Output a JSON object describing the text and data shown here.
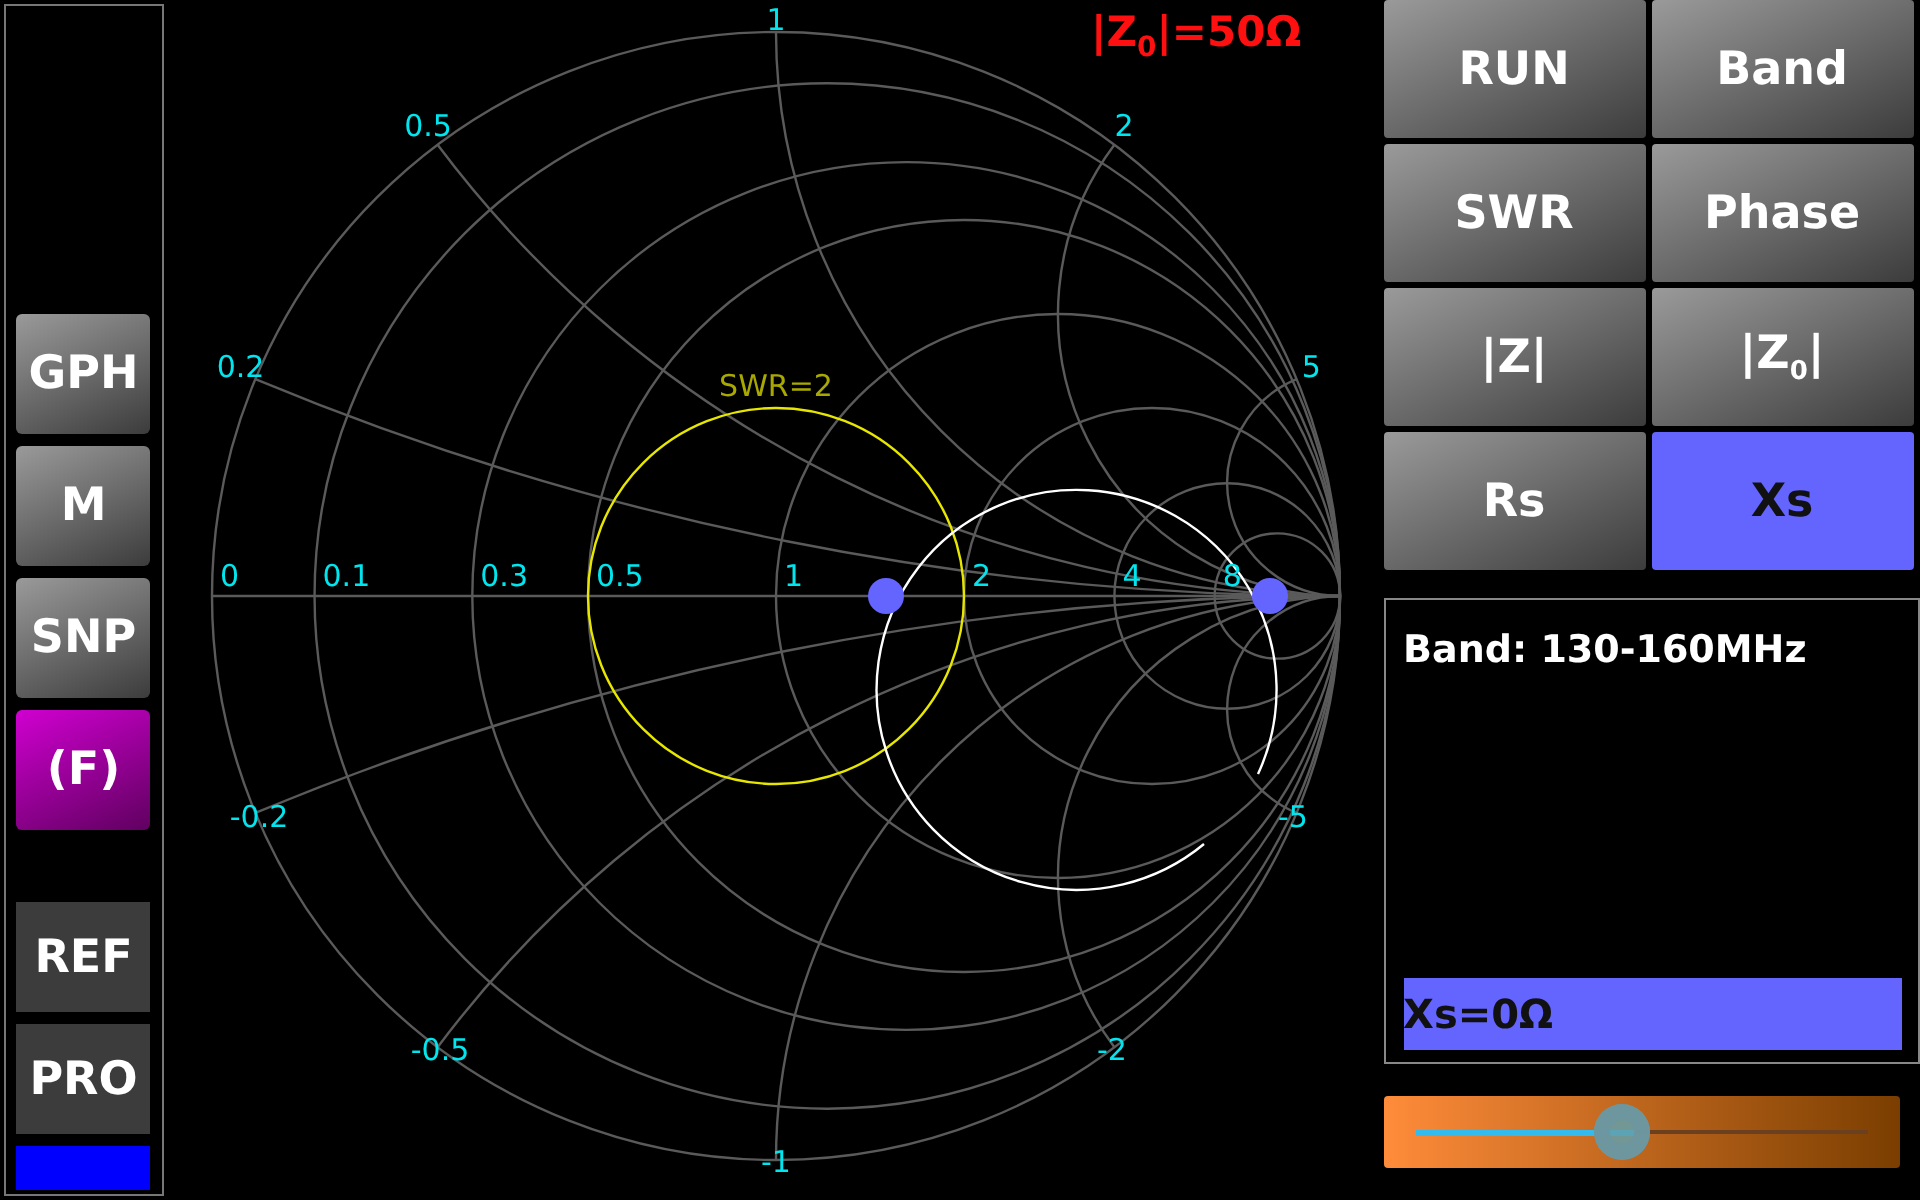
{
  "sidebar": {
    "buttons": [
      {
        "label": "GPH",
        "kind": "raised",
        "selected": false
      },
      {
        "label": "M",
        "kind": "raised",
        "selected": false
      },
      {
        "label": "SNP",
        "kind": "raised",
        "selected": false
      },
      {
        "label": "(F)",
        "kind": "raised",
        "selected": true
      },
      {
        "label": "REF",
        "kind": "flat",
        "selected": false
      },
      {
        "label": "PRO",
        "kind": "flat",
        "selected": false
      }
    ]
  },
  "chart": {
    "impedance_label": "|Z$_{0}$|=50Ω",
    "resistance_labels": [
      "0",
      "0.1",
      "0.3",
      "0.5",
      "1",
      "2",
      "4",
      "8"
    ],
    "reactance_labels": [
      "1",
      "0.5",
      "2",
      "0.2",
      "5",
      "-0.2",
      "-5",
      "-0.5",
      "-2",
      "-1"
    ],
    "swr_label": "SWR=2"
  },
  "buttons": [
    {
      "label": "RUN",
      "selected": false
    },
    {
      "label": "Band",
      "selected": false
    },
    {
      "label": "SWR",
      "selected": false
    },
    {
      "label": "Phase",
      "selected": false
    },
    {
      "label": "|Z|",
      "selected": false
    },
    {
      "label": "|Z$_{0}$|",
      "selected": false
    },
    {
      "label": "Rs",
      "selected": false
    },
    {
      "label": "Xs",
      "selected": true
    }
  ],
  "info_panel": {
    "band": "Band: 130-160MHz",
    "readout": "Xs=0Ω"
  },
  "slider": {
    "level": 0.49
  }
}
